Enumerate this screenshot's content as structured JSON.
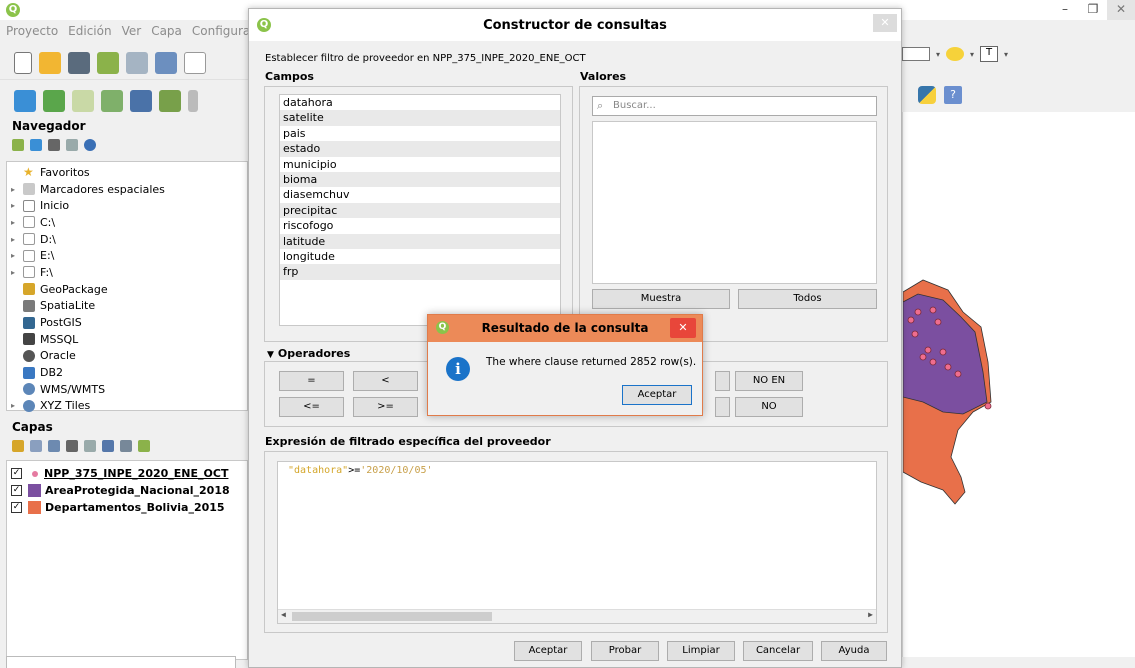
{
  "qgis": {
    "menu": [
      "Proyecto",
      "Edición",
      "Ver",
      "Capa",
      "Configurac"
    ],
    "navigator": {
      "title": "Navegador",
      "items": [
        {
          "label": "Favoritos",
          "icon": "star-icon"
        },
        {
          "label": "Marcadores espaciales",
          "icon": "bookmark-icon"
        },
        {
          "label": "Inicio",
          "icon": "home-folder-icon"
        },
        {
          "label": "C:\\",
          "icon": "folder-icon"
        },
        {
          "label": "D:\\",
          "icon": "folder-icon"
        },
        {
          "label": "E:\\",
          "icon": "folder-icon"
        },
        {
          "label": "F:\\",
          "icon": "folder-icon"
        },
        {
          "label": "GeoPackage",
          "icon": "geopackage-icon"
        },
        {
          "label": "SpatiaLite",
          "icon": "spatialite-icon"
        },
        {
          "label": "PostGIS",
          "icon": "postgis-icon"
        },
        {
          "label": "MSSQL",
          "icon": "mssql-icon"
        },
        {
          "label": "Oracle",
          "icon": "oracle-icon"
        },
        {
          "label": "DB2",
          "icon": "db2-icon"
        },
        {
          "label": "WMS/WMTS",
          "icon": "wms-icon"
        },
        {
          "label": "XYZ Tiles",
          "icon": "xyz-icon"
        }
      ]
    },
    "layers": {
      "title": "Capas",
      "items": [
        {
          "label": "NPP_375_INPE_2020_ENE_OCT",
          "color": "#e57ba1"
        },
        {
          "label": "AreaProtegida_Nacional_2018",
          "color": "#7b4fa0"
        },
        {
          "label": "Departamentos_Bolivia_2015",
          "color": "#e8704a"
        }
      ]
    },
    "colors": {
      "accent": "#8bc34a",
      "polygon_purple": "#7b4fa0",
      "polygon_orange": "#e8704a",
      "points": "#ef6d8e"
    }
  },
  "query_builder": {
    "title": "Constructor de consultas",
    "filter_label": "Establecer filtro de proveedor en NPP_375_INPE_2020_ENE_OCT",
    "fields_label": "Campos",
    "values_label": "Valores",
    "fields": [
      "datahora",
      "satelite",
      "pais",
      "estado",
      "municipio",
      "bioma",
      "diasemchuv",
      "precipitac",
      "riscofogo",
      "latitude",
      "longitude",
      "frp"
    ],
    "search_placeholder": "Buscar...",
    "sample_button": "Muestra",
    "all_button": "Todos",
    "operators_label": "Operadores",
    "operators": {
      "eq": "=",
      "lt": "<",
      "le": "<=",
      "ge": ">=",
      "not_in": "NO EN",
      "not": "NO"
    },
    "expression_label": "Expresión de filtrado específica del proveedor",
    "expression_field": "\"datahora\"",
    "expression_op": ">=",
    "expression_value": "'2020/10/05'",
    "buttons": {
      "accept": "Aceptar",
      "test": "Probar",
      "clear": "Limpiar",
      "cancel": "Cancelar",
      "help": "Ayuda"
    }
  },
  "result_dialog": {
    "title": "Resultado de la consulta",
    "message": "The where clause returned 2852 row(s).",
    "ok": "Aceptar"
  }
}
